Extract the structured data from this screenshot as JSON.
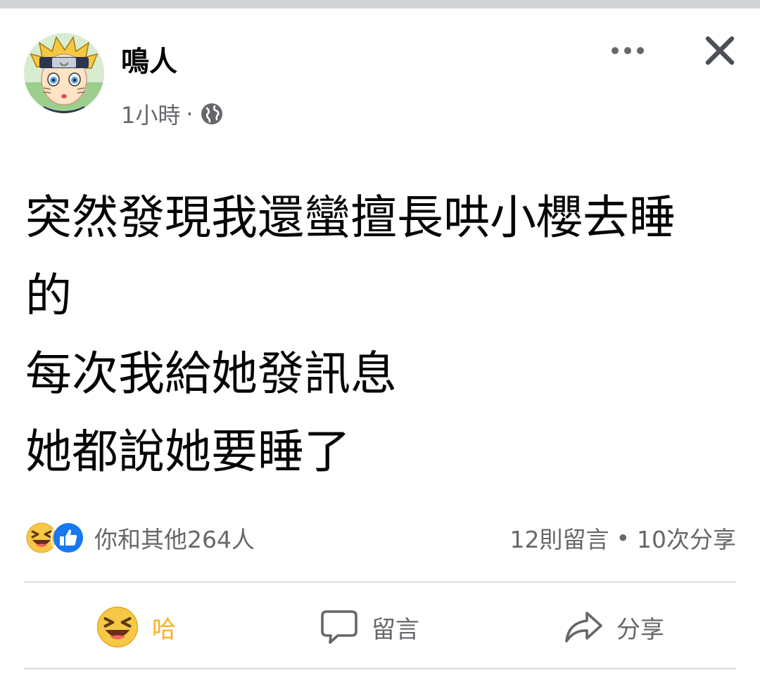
{
  "post": {
    "author": "鳴人",
    "time": "1小時",
    "separator": "·",
    "privacy_icon": "globe-icon",
    "lines": [
      "突然發現我還蠻擅長哄小櫻去睡",
      "的",
      "每次我給她發訊息",
      "她都說她要睡了"
    ]
  },
  "stats": {
    "reaction_icons": [
      "haha-reaction-icon",
      "like-reaction-icon"
    ],
    "reactions_text": "你和其他264人",
    "comments_text": "12則留言",
    "dot": "•",
    "shares_text": "10次分享"
  },
  "actions": {
    "haha_label": "哈",
    "comment_label": "留言",
    "share_label": "分享"
  },
  "colors": {
    "haha_active": "#f7b125",
    "like_blue": "#1877f2",
    "secondary_text": "#65676b",
    "divider": "#dadde1"
  }
}
